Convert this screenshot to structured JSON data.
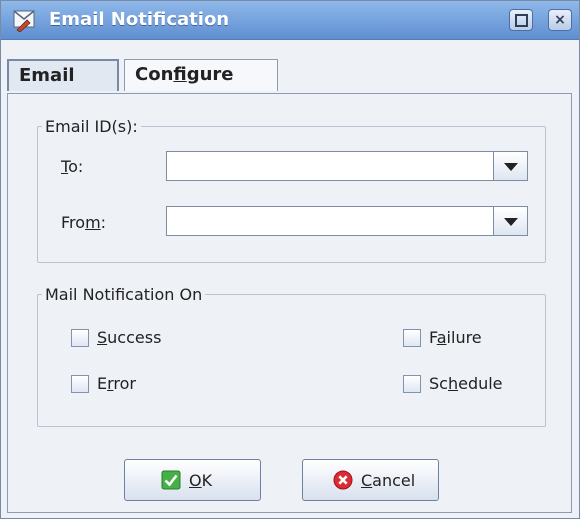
{
  "window": {
    "title": "Email Notification",
    "close_glyph": "×"
  },
  "tabs": [
    {
      "label": "Email",
      "active": true
    },
    {
      "label_pre": "Con",
      "label_mnemonic": "f",
      "label_post": "igure",
      "active": false
    }
  ],
  "email_group": {
    "legend": "Email ID(s):",
    "to": {
      "label_mnemonic": "T",
      "label_post": "o:",
      "value": ""
    },
    "from": {
      "label_pre": "Fro",
      "label_mnemonic": "m",
      "label_post": ":",
      "value": ""
    }
  },
  "notify_group": {
    "legend": "Mail Notification On",
    "options": {
      "success": {
        "mnemonic": "S",
        "rest": "uccess",
        "checked": false
      },
      "failure": {
        "pre": "F",
        "mnemonic": "a",
        "rest": "ilure",
        "checked": false
      },
      "error": {
        "pre": "E",
        "mnemonic": "r",
        "rest": "ror",
        "checked": false
      },
      "schedule": {
        "pre": "Sc",
        "mnemonic": "h",
        "rest": "edule",
        "checked": false
      }
    }
  },
  "buttons": {
    "ok": {
      "mnemonic": "O",
      "rest": "K"
    },
    "cancel": {
      "mnemonic": "C",
      "rest": "ancel"
    }
  },
  "colors": {
    "titlebar": "#6f9cdc",
    "panel": "#eef1f6",
    "ok_icon": "#3aa53a",
    "cancel_icon": "#d9232e"
  }
}
